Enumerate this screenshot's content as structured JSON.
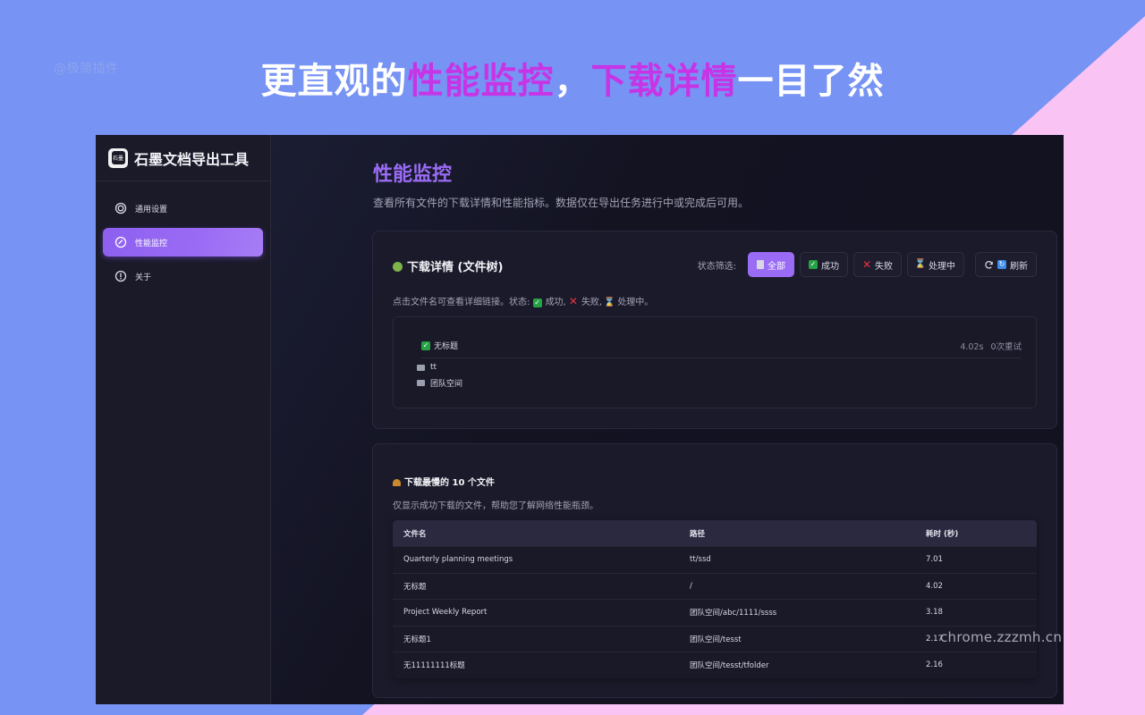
{
  "banner": {
    "watermark": "@极简插件",
    "headline_part1": "更直观的",
    "headline_part2": "性能监控",
    "headline_part3": "，",
    "headline_part4": "下载详情",
    "headline_part5": "一目了然",
    "highlight_color": "#c734e6"
  },
  "sidebar": {
    "logo_text": "石墨",
    "app_title": "石墨文档导出工具",
    "items": [
      {
        "label": "通用设置",
        "icon": "settings-icon"
      },
      {
        "label": "性能监控",
        "icon": "performance-icon",
        "active": true
      },
      {
        "label": "关于",
        "icon": "info-icon"
      }
    ]
  },
  "main": {
    "title": "性能监控",
    "description": "查看所有文件的下载详情和性能指标。数据仅在导出任务进行中或完成后可用。",
    "accent_color": "#9a6cf5"
  },
  "download_card": {
    "title": "下载详情 (文件树)",
    "filter_label": "状态筛选:",
    "filters": {
      "all": "全部",
      "success": "成功",
      "failed": "失败",
      "processing": "处理中",
      "refresh": "刷新"
    },
    "legend_prefix": "点击文件名可查看详细链接。状态:",
    "legend_success": "成功,",
    "legend_failed": "失败,",
    "legend_processing": "处理中。",
    "tree": {
      "root": {
        "name": "无标题",
        "time": "4.02s",
        "retries": "0次重试",
        "status": "success"
      },
      "children": [
        {
          "name": "tt"
        },
        {
          "name": "团队空间"
        }
      ]
    }
  },
  "slow_card": {
    "title": "下载最慢的 10 个文件",
    "description": "仅显示成功下载的文件，帮助您了解网络性能瓶颈。",
    "columns": [
      "文件名",
      "路径",
      "耗时 (秒)"
    ],
    "rows": [
      [
        "Quarterly planning meetings",
        "tt/ssd",
        "7.01"
      ],
      [
        "无标题",
        "/",
        "4.02"
      ],
      [
        "Project Weekly Report",
        "团队空间/abc/1111/ssss",
        "3.18"
      ],
      [
        "无标题1",
        "团队空间/tesst",
        "2.17"
      ],
      [
        "无11111111标题",
        "团队空间/tesst/tfolder",
        "2.16"
      ]
    ]
  },
  "watermark_br": "chrome.zzzmh.cn"
}
